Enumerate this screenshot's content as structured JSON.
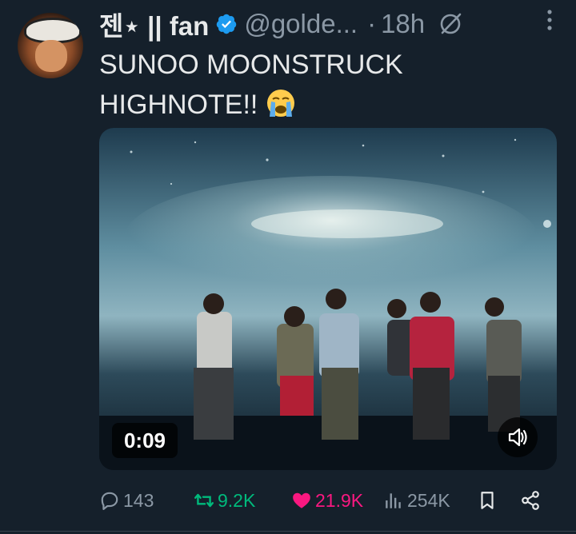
{
  "tweet": {
    "display_name": "젠⋆ || fan",
    "handle": "@golde...",
    "separator": "·",
    "time": "18h",
    "text_line1": "SUNOO MOONSTRUCK",
    "text_line2": "HIGHNOTE!!",
    "emoji": "loudly-crying-face"
  },
  "media": {
    "duration": "0:09",
    "volume_icon": "speaker-icon"
  },
  "actions": {
    "replies": "143",
    "retweets": "9.2K",
    "likes": "21.9K",
    "views": "254K"
  },
  "colors": {
    "background": "#15202b",
    "secondary_text": "#8b98a5",
    "verified": "#1d9bf0",
    "retweet_active": "#00ba7c",
    "like_active": "#f91880"
  }
}
